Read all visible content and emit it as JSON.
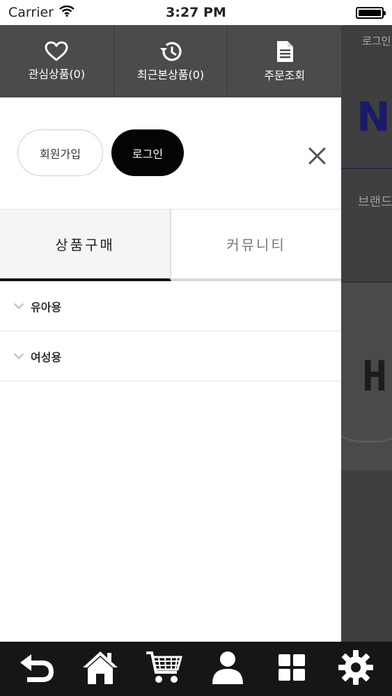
{
  "status_bar": {
    "carrier": "Carrier",
    "time": "3:27 PM"
  },
  "background_page": {
    "login_text": "로그인",
    "logo_text": "N",
    "brand_text": "브랜드",
    "product_text": "H"
  },
  "drawer": {
    "top_menu": [
      {
        "label": "관심상품(0)",
        "icon": "heart-icon"
      },
      {
        "label": "최근본상품(0)",
        "icon": "history-icon"
      },
      {
        "label": "주문조회",
        "icon": "document-icon"
      }
    ],
    "join_label": "회원가입",
    "login_label": "로그인",
    "tabs": [
      {
        "label": "상품구매",
        "active": true
      },
      {
        "label": "커뮤니티",
        "active": false
      }
    ],
    "categories": [
      {
        "label": "유아용"
      },
      {
        "label": "여성용"
      }
    ]
  },
  "toolbar": {
    "items": [
      "back-icon",
      "home-icon",
      "cart-icon",
      "user-icon",
      "grid-icon",
      "gear-icon"
    ]
  },
  "colors": {
    "drawer_header": "#4b4b4b",
    "login_button": "#050505",
    "toolbar": "#161616",
    "overlay": "#3f3f3f"
  }
}
